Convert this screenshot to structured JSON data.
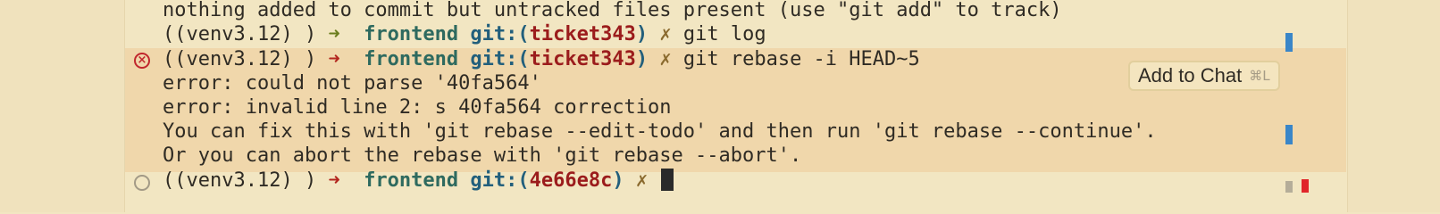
{
  "terminal": {
    "lines": [
      {
        "text": "nothing added to commit but untracked files present (use \"git add\" to track)"
      },
      {
        "venv": "((venv3.12) )",
        "arrow": "➜",
        "dir": "frontend",
        "git_label": "git:(",
        "branch": "ticket343",
        "git_close": ")",
        "xmark": "✗",
        "command": "git log"
      },
      {
        "venv": "((venv3.12) )",
        "arrow": "➜",
        "dir": "frontend",
        "git_label": "git:(",
        "branch": "ticket343",
        "git_close": ")",
        "xmark": "✗",
        "command": "git rebase -i HEAD~5"
      },
      {
        "text": "error: could not parse '40fa564'"
      },
      {
        "text": "error: invalid line 2: s 40fa564 correction"
      },
      {
        "text": "You can fix this with 'git rebase --edit-todo' and then run 'git rebase --continue'."
      },
      {
        "text": "Or you can abort the rebase with 'git rebase --abort'."
      },
      {
        "venv": "((venv3.12) )",
        "arrow": "➜",
        "dir": "frontend",
        "git_label": "git:(",
        "branch": "4e66e8c",
        "git_close": ")",
        "xmark": "✗",
        "command": ""
      }
    ],
    "error_icon": "×"
  },
  "add_to_chat": {
    "label": "Add to Chat",
    "shortcut": "⌘L"
  },
  "icons": {
    "error_status": "error-circle-icon",
    "idle_status": "idle-circle-icon"
  },
  "colors": {
    "background": "#f2e6c2",
    "error_highlight": "#f0d7ab",
    "arrow_success": "#6b7d1e",
    "arrow_error": "#b3261e",
    "branch": "#9b1c1c",
    "git_label": "#225f7c",
    "scroll_marker_blue": "#3a86c8",
    "scroll_marker_red": "#e0262a",
    "scroll_marker_gray": "#b5ad99"
  }
}
